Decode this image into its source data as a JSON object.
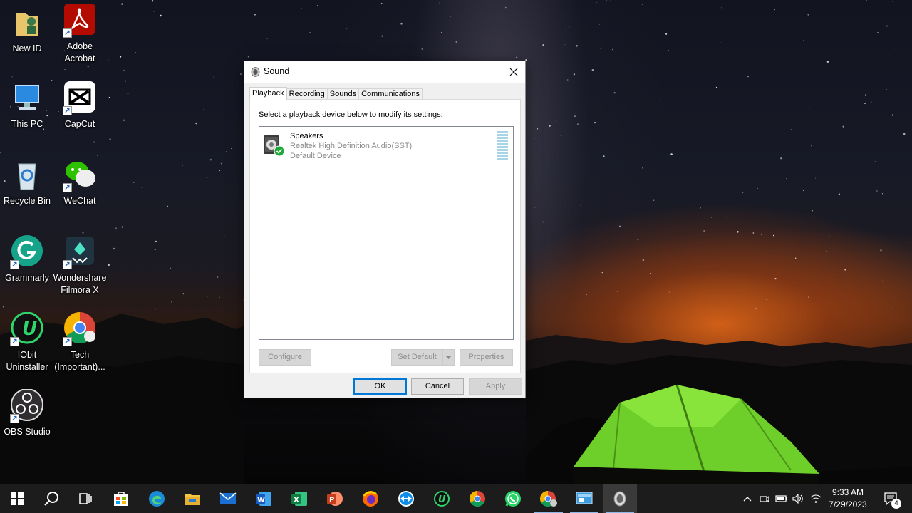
{
  "desktop": {
    "icons": [
      {
        "label": "New ID"
      },
      {
        "label": "Adobe Acrobat"
      },
      {
        "label": "This PC"
      },
      {
        "label": "CapCut"
      },
      {
        "label": "Recycle Bin"
      },
      {
        "label": "WeChat"
      },
      {
        "label": "Grammarly"
      },
      {
        "label": "Wondershare Filmora X"
      },
      {
        "label": "IObit Uninstaller"
      },
      {
        "label": "Tech (Important)..."
      },
      {
        "label": "OBS Studio"
      }
    ]
  },
  "dialog": {
    "title": "Sound",
    "tabs": [
      "Playback",
      "Recording",
      "Sounds",
      "Communications"
    ],
    "instruction": "Select a playback device below to modify its settings:",
    "device": {
      "name": "Speakers",
      "description": "Realtek High Definition Audio(SST)",
      "status": "Default Device"
    },
    "buttons": {
      "configure": "Configure",
      "set_default": "Set Default",
      "properties": "Properties",
      "ok": "OK",
      "cancel": "Cancel",
      "apply": "Apply"
    }
  },
  "taskbar": {
    "time": "9:33 AM",
    "date": "7/29/2023",
    "notification_count": "4"
  }
}
